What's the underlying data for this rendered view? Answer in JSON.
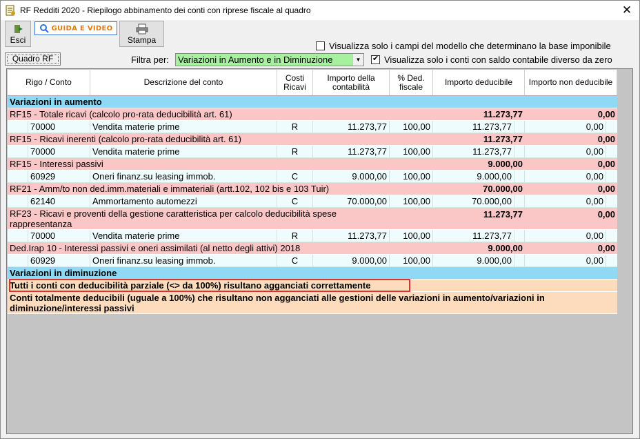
{
  "window": {
    "title": "RF Redditi 2020 - Riepilogo abbinamento dei conti con riprese fiscale al quadro",
    "close_label": "✕"
  },
  "toolbar": {
    "esci_label": "Esci",
    "guida_label": "GUIDA E VIDEO",
    "stampa_label": "Stampa"
  },
  "tab": {
    "label": "Quadro RF"
  },
  "filters": {
    "filtra_label": "Filtra per:",
    "filtra_value": "Variazioni in Aumento e in Diminuzione",
    "chk_campi_label": "Visualizza solo i campi del modello che determinano la base imponibile",
    "chk_campi_checked": false,
    "chk_saldo_label": "Visualizza solo i conti con saldo contabile diverso da zero",
    "chk_saldo_checked": true
  },
  "table": {
    "headers": {
      "rigo": "Rigo / Conto",
      "descrizione": "Descrizione del conto",
      "costi": "Costi Ricavi",
      "importo_contabilita": "Importo della contabilità",
      "ded_fiscale": "% Ded. fiscale",
      "importo_deducibile": "Importo deducibile",
      "importo_non_deducibile": "Importo non deducibile"
    },
    "section_aumento": "Variazioni in aumento",
    "groups": [
      {
        "label": "RF15 - Totale ricavi (calcolo pro-rata deducibilità art. 61)",
        "deducibile": "11.273,77",
        "non_deducibile": "0,00",
        "detail": {
          "conto": "70000",
          "descrizione": "Vendita materie prime",
          "cr": "R",
          "contabilita": "11.273,77",
          "perc": "100,00",
          "deducibile": "11.273,77",
          "non_deducibile": "0,00"
        }
      },
      {
        "label": "RF15 - Ricavi inerenti (calcolo pro-rata deducibilità art. 61)",
        "deducibile": "11.273,77",
        "non_deducibile": "0,00",
        "detail": {
          "conto": "70000",
          "descrizione": "Vendita materie prime",
          "cr": "R",
          "contabilita": "11.273,77",
          "perc": "100,00",
          "deducibile": "11.273,77",
          "non_deducibile": "0,00"
        }
      },
      {
        "label": "RF15 - Interessi passivi",
        "deducibile": "9.000,00",
        "non_deducibile": "0,00",
        "detail": {
          "conto": "60929",
          "descrizione": "Oneri finanz.su leasing immob.",
          "cr": "C",
          "contabilita": "9.000,00",
          "perc": "100,00",
          "deducibile": "9.000,00",
          "non_deducibile": "0,00"
        }
      },
      {
        "label": "RF21 - Amm/to non ded.imm.materiali e immateriali (artt.102, 102 bis e 103 Tuir)",
        "deducibile": "70.000,00",
        "non_deducibile": "0,00",
        "detail": {
          "conto": "62140",
          "descrizione": "Ammortamento automezzi",
          "cr": "C",
          "contabilita": "70.000,00",
          "perc": "100,00",
          "deducibile": "70.000,00",
          "non_deducibile": "0,00"
        }
      },
      {
        "label_line1": "RF23 - Ricavi e proventi della gestione caratteristica per calcolo deducibilità spese",
        "label_line2": "rappresentanza",
        "deducibile": "11.273,77",
        "non_deducibile": "0,00",
        "detail": {
          "conto": "70000",
          "descrizione": "Vendita materie prime",
          "cr": "R",
          "contabilita": "11.273,77",
          "perc": "100,00",
          "deducibile": "11.273,77",
          "non_deducibile": "0,00"
        }
      },
      {
        "label": "Ded.Irap 10 - Interessi passivi e oneri assimilati (al netto degli attivi) 2018",
        "deducibile": "9.000,00",
        "non_deducibile": "0,00",
        "detail": {
          "conto": "60929",
          "descrizione": "Oneri finanz.su leasing immob.",
          "cr": "C",
          "contabilita": "9.000,00",
          "perc": "100,00",
          "deducibile": "9.000,00",
          "non_deducibile": "0,00"
        }
      }
    ],
    "section_diminuzione": "Variazioni in diminuzione",
    "note1": "Tutti i conti con deducibilità parziale (<> da 100%) risultano agganciati correttamente",
    "note2_line1": "Conti totalmente deducibili (uguale a 100%) che risultano non agganciati alle gestioni delle variazioni in aumento/variazioni in",
    "note2_line2": "diminuzione/interessi passivi"
  }
}
